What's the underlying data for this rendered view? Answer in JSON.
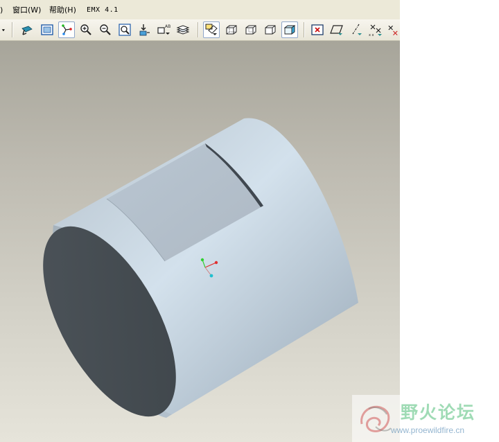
{
  "menubar": {
    "items": [
      {
        "label": ")",
        "accel": ""
      },
      {
        "label": "窗口",
        "accel": "(W)"
      },
      {
        "label": "帮助",
        "accel": "(H)"
      },
      {
        "label": "EMX 4.1",
        "accel": ""
      }
    ]
  },
  "toolbar": {
    "buttons": [
      {
        "icon": "dropdown-arrow-icon"
      },
      {
        "icon": "repaint-icon"
      },
      {
        "icon": "refit-icon"
      },
      {
        "icon": "spin-center-icon",
        "active": true
      },
      {
        "icon": "zoom-in-icon"
      },
      {
        "icon": "zoom-out-icon"
      },
      {
        "icon": "zoom-fit-icon"
      },
      {
        "icon": "reorient-icon"
      },
      {
        "icon": "saved-views-icon"
      },
      {
        "icon": "layers-icon"
      },
      {
        "icon": "wireframe-icon",
        "active": true
      },
      {
        "icon": "hidden-line-icon"
      },
      {
        "icon": "no-hidden-icon"
      },
      {
        "icon": "shading-icon"
      },
      {
        "icon": "shaded-icon",
        "active": true
      },
      {
        "icon": "datum-display-icon"
      },
      {
        "icon": "datum-plane-icon"
      },
      {
        "icon": "datum-axis-icon"
      },
      {
        "icon": "datum-point-icon"
      },
      {
        "icon": "coordinate-system-icon"
      }
    ]
  },
  "colors": {
    "model_light": "#cfdde8",
    "model_dark": "#4c5359",
    "axis_x": "#e03030",
    "axis_y": "#30d030",
    "axis_z": "#20c0d0"
  },
  "watermark": {
    "title": "野火论坛",
    "url": "www.proewildfire.cn"
  }
}
